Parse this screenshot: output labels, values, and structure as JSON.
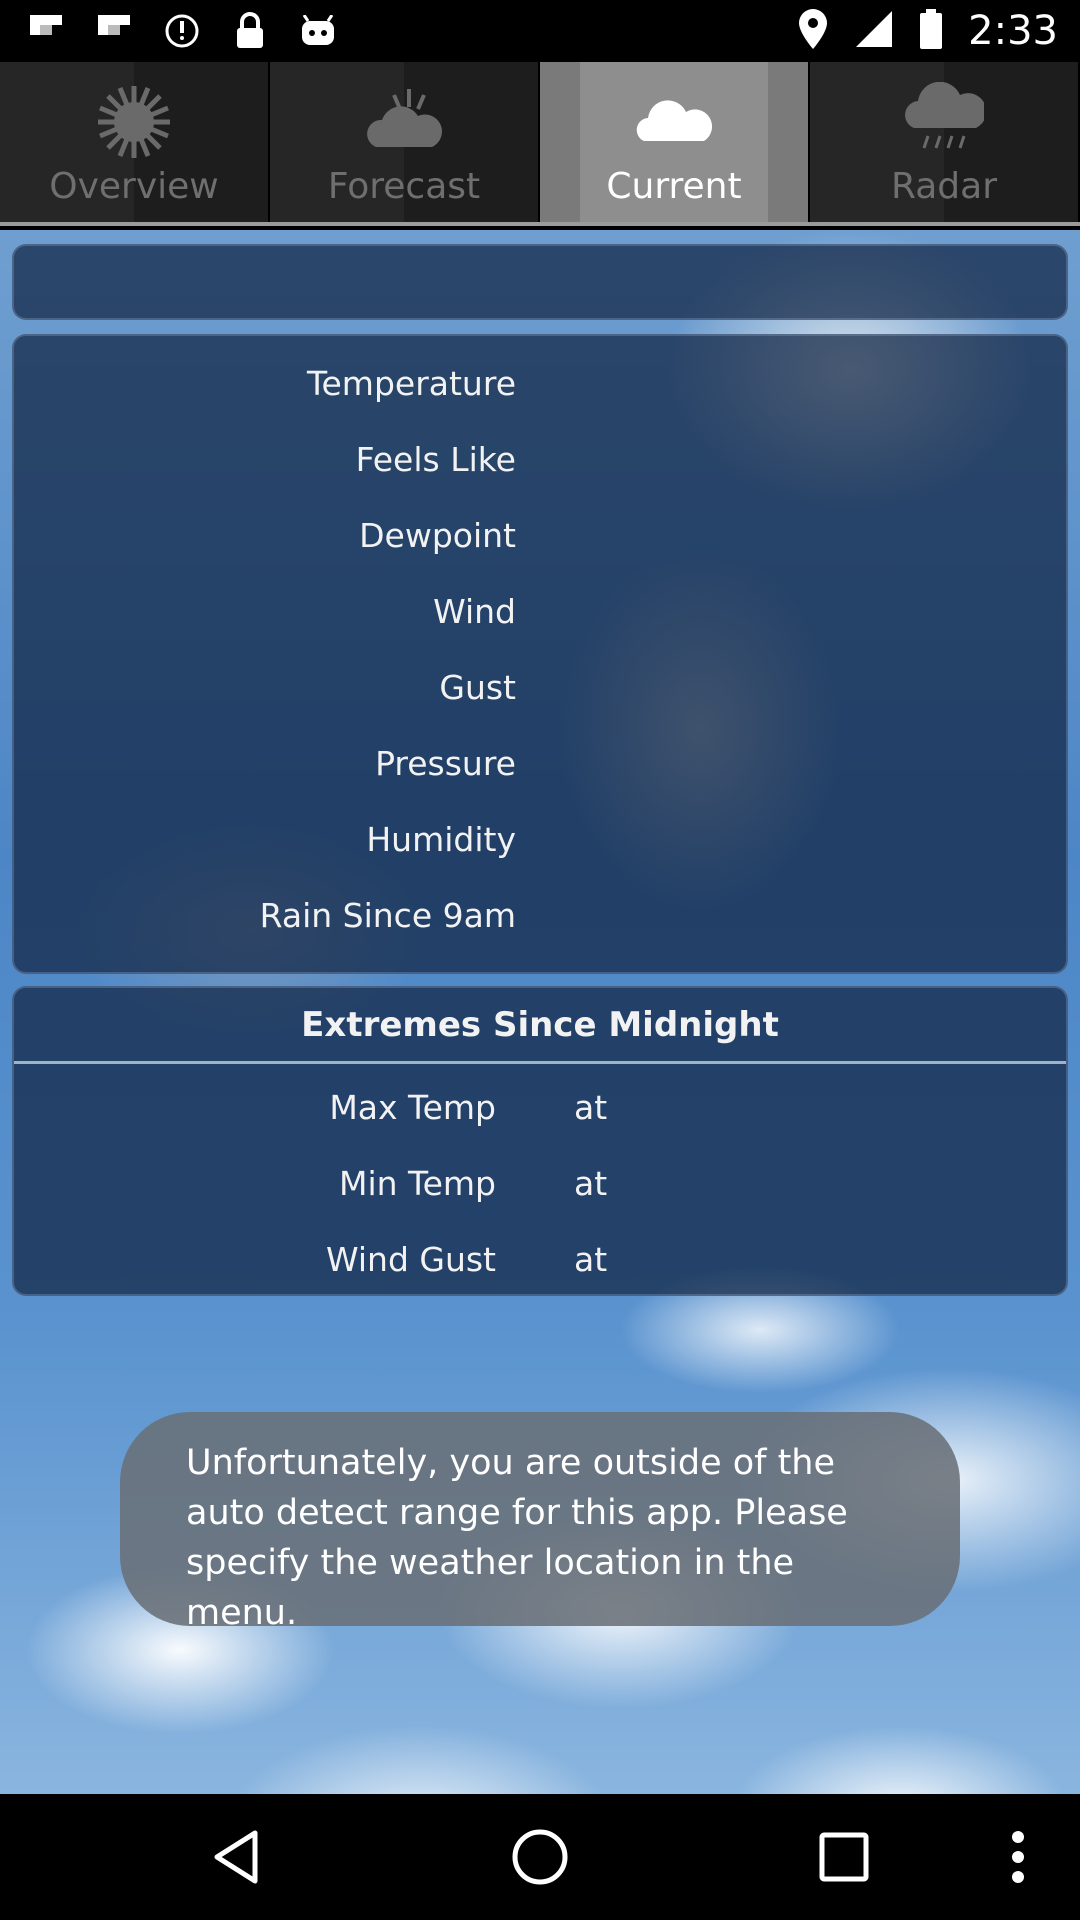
{
  "status_bar": {
    "time": "2:33",
    "left_icons": [
      "flipboard-icon",
      "flipboard-icon",
      "alarm-icon",
      "lock-icon",
      "android-icon"
    ],
    "right_icons": [
      "location-icon",
      "signal-icon",
      "battery-icon"
    ]
  },
  "tabs": [
    {
      "label": "Overview",
      "icon": "sun-icon",
      "active": false
    },
    {
      "label": "Forecast",
      "icon": "partly-cloudy-icon",
      "active": false
    },
    {
      "label": "Current",
      "icon": "cloud-icon",
      "active": true
    },
    {
      "label": "Radar",
      "icon": "rain-cloud-icon",
      "active": false
    }
  ],
  "current": {
    "rows": [
      {
        "label": "Temperature"
      },
      {
        "label": "Feels Like"
      },
      {
        "label": "Dewpoint"
      },
      {
        "label": "Wind"
      },
      {
        "label": "Gust"
      },
      {
        "label": "Pressure"
      },
      {
        "label": "Humidity"
      },
      {
        "label": "Rain Since 9am"
      }
    ]
  },
  "extremes": {
    "title": "Extremes Since Midnight",
    "rows": [
      {
        "label": "Max Temp",
        "at": "at"
      },
      {
        "label": "Min Temp",
        "at": "at"
      },
      {
        "label": "Wind Gust",
        "at": "at"
      }
    ]
  },
  "toast": {
    "message": "Unfortunately, you are outside of the auto detect range for this app. Please specify the weather location in the menu."
  },
  "nav_bar": {
    "icons": [
      "back-icon",
      "home-icon",
      "recents-icon",
      "more-options-icon"
    ]
  }
}
